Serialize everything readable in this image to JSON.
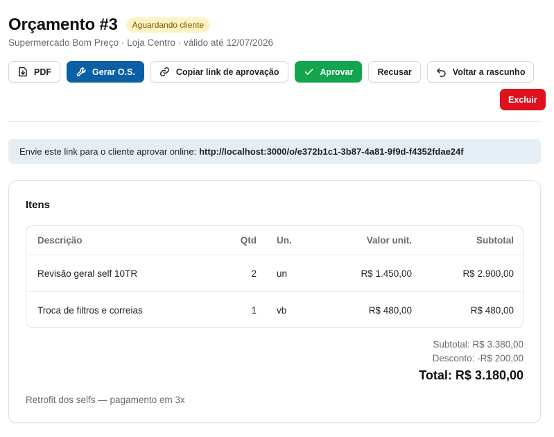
{
  "header": {
    "title": "Orçamento #3",
    "status_badge": "Aguardando cliente",
    "subtitle": "Supermercado Bom Preço · Loja Centro · válido até 12/07/2026"
  },
  "toolbar": {
    "pdf": {
      "label": "PDF",
      "icon": "file-download-icon"
    },
    "gerar_os": {
      "label": "Gerar O.S.",
      "icon": "wrench-icon"
    },
    "copiar_link": {
      "label": "Copiar link de aprovação",
      "icon": "link-icon"
    },
    "aprovar": {
      "label": "Aprovar",
      "icon": "check-icon"
    },
    "recusar": {
      "label": "Recusar"
    },
    "voltar_rascunho": {
      "label": "Voltar a rascunho",
      "icon": "undo-icon"
    },
    "excluir": {
      "label": "Excluir"
    }
  },
  "approval_link": {
    "text": "Envie este link para o cliente aprovar online:",
    "url": "http://localhost:3000/o/e372b1c1-3b87-4a81-9f9d-f4352fdae24f"
  },
  "items_card": {
    "title": "Itens",
    "columns": [
      "Descrição",
      "Qtd",
      "Un.",
      "Valor unit.",
      "Subtotal"
    ],
    "rows": [
      [
        "Revisão geral self 10TR",
        "2",
        "un",
        "R$ 1.450,00",
        "R$ 2.900,00"
      ],
      [
        "Troca de filtros e correias",
        "1",
        "vb",
        "R$ 480,00",
        "R$ 480,00"
      ]
    ],
    "subtotal": "Subtotal: R$ 3.380,00",
    "desconto": "Desconto: -R$ 200,00",
    "total": "Total: R$ 3.180,00",
    "note": "Retrofit dos selfs — pagamento em 3x"
  },
  "colors": {
    "primary": "#0b5fa5",
    "success": "#14a44d",
    "danger": "#e0111f",
    "badge_bg": "#fdf3c4",
    "link_box_bg": "#e6eef5"
  }
}
